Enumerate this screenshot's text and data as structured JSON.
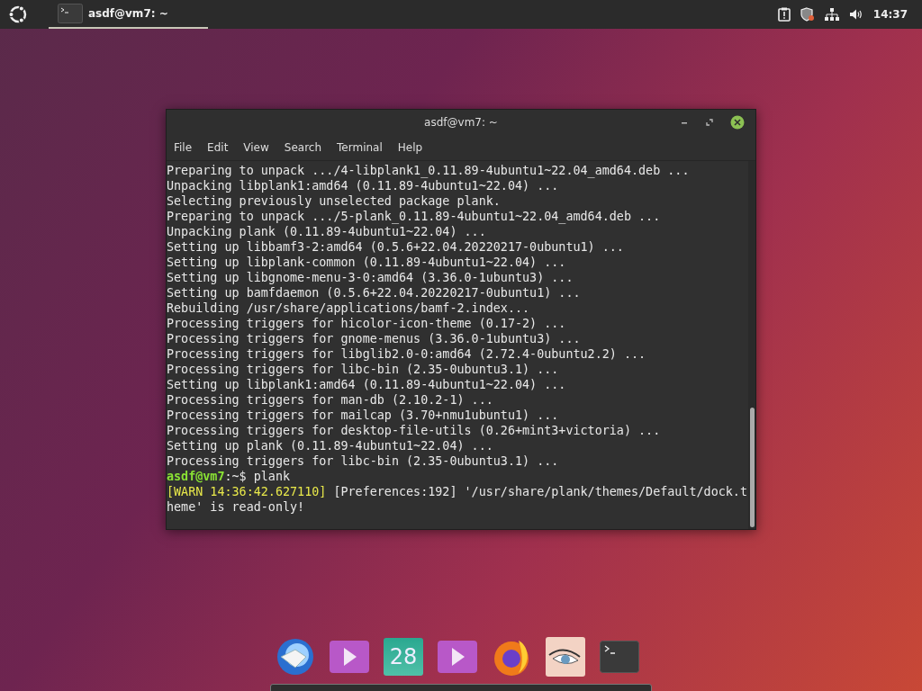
{
  "top_bar": {
    "tasks": [
      {
        "label": "asdf@vm7: ~",
        "selected": true
      }
    ],
    "clock": "14:37"
  },
  "terminal": {
    "title": "asdf@vm7: ~",
    "menu": [
      "File",
      "Edit",
      "View",
      "Search",
      "Terminal",
      "Help"
    ],
    "lines": [
      [
        {
          "text": "Preparing to unpack .../4-libplank1_0.11.89-4ubuntu1~22.04_amd64.deb ...",
          "kind": "plain"
        }
      ],
      [
        {
          "text": "Unpacking libplank1:amd64 (0.11.89-4ubuntu1~22.04) ...",
          "kind": "plain"
        }
      ],
      [
        {
          "text": "Selecting previously unselected package plank.",
          "kind": "plain"
        }
      ],
      [
        {
          "text": "Preparing to unpack .../5-plank_0.11.89-4ubuntu1~22.04_amd64.deb ...",
          "kind": "plain"
        }
      ],
      [
        {
          "text": "Unpacking plank (0.11.89-4ubuntu1~22.04) ...",
          "kind": "plain"
        }
      ],
      [
        {
          "text": "Setting up libbamf3-2:amd64 (0.5.6+22.04.20220217-0ubuntu1) ...",
          "kind": "plain"
        }
      ],
      [
        {
          "text": "Setting up libplank-common (0.11.89-4ubuntu1~22.04) ...",
          "kind": "plain"
        }
      ],
      [
        {
          "text": "Setting up libgnome-menu-3-0:amd64 (3.36.0-1ubuntu3) ...",
          "kind": "plain"
        }
      ],
      [
        {
          "text": "Setting up bamfdaemon (0.5.6+22.04.20220217-0ubuntu1) ...",
          "kind": "plain"
        }
      ],
      [
        {
          "text": "Rebuilding /usr/share/applications/bamf-2.index...",
          "kind": "plain"
        }
      ],
      [
        {
          "text": "Processing triggers for hicolor-icon-theme (0.17-2) ...",
          "kind": "plain"
        }
      ],
      [
        {
          "text": "Processing triggers for gnome-menus (3.36.0-1ubuntu3) ...",
          "kind": "plain"
        }
      ],
      [
        {
          "text": "Processing triggers for libglib2.0-0:amd64 (2.72.4-0ubuntu2.2) ...",
          "kind": "plain"
        }
      ],
      [
        {
          "text": "Processing triggers for libc-bin (2.35-0ubuntu3.1) ...",
          "kind": "plain"
        }
      ],
      [
        {
          "text": "Setting up libplank1:amd64 (0.11.89-4ubuntu1~22.04) ...",
          "kind": "plain"
        }
      ],
      [
        {
          "text": "Processing triggers for man-db (2.10.2-1) ...",
          "kind": "plain"
        }
      ],
      [
        {
          "text": "Processing triggers for mailcap (3.70+nmu1ubuntu1) ...",
          "kind": "plain"
        }
      ],
      [
        {
          "text": "Processing triggers for desktop-file-utils (0.26+mint3+victoria) ...",
          "kind": "plain"
        }
      ],
      [
        {
          "text": "Setting up plank (0.11.89-4ubuntu1~22.04) ...",
          "kind": "plain"
        }
      ],
      [
        {
          "text": "Processing triggers for libc-bin (2.35-0ubuntu3.1) ...",
          "kind": "plain"
        }
      ],
      [
        {
          "text": "asdf@vm7",
          "kind": "user"
        },
        {
          "text": ":~$ plank",
          "kind": "plain"
        }
      ],
      [
        {
          "text": "[WARN 14:36:42.627110]",
          "kind": "warn"
        },
        {
          "text": " [Preferences:192] '/usr/share/plank/themes/Default/dock.t",
          "kind": "plain"
        }
      ],
      [
        {
          "text": "heme' is read-only!",
          "kind": "plain"
        }
      ]
    ]
  },
  "dock": {
    "items": [
      {
        "kind": "mail"
      },
      {
        "kind": "video"
      },
      {
        "kind": "calendar",
        "label": "28"
      },
      {
        "kind": "video"
      },
      {
        "kind": "browser"
      },
      {
        "kind": "eye"
      },
      {
        "kind": "terminal"
      }
    ]
  }
}
